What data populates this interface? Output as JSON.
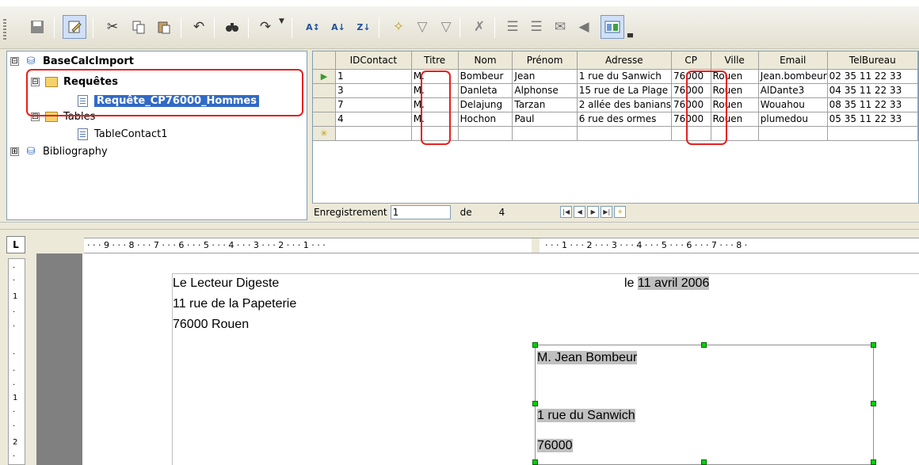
{
  "toolbar": {
    "icons": [
      "save-icon",
      "edit-icon",
      "cut-icon",
      "copy-icon",
      "paste-icon",
      "undo-icon",
      "find-icon",
      "redo-icon",
      "sort-icon",
      "sort-ascending-icon",
      "sort-descending-icon",
      "autofilter-icon",
      "filter-icon",
      "standard-filter-icon",
      "remove-filter-icon",
      "data-to-text-icon",
      "data-to-fields-icon",
      "mail-merge-icon",
      "data-source-icon",
      "explorer-icon"
    ],
    "grip": "partial"
  },
  "tree": {
    "database": "BaseCalcImport",
    "queries_folder": "Requêtes",
    "query_item": "Requête_CP76000_Hommes",
    "tables_folder": "Tables",
    "table_item": "TableContact1",
    "other_database": "Bibliography",
    "toggle_minus": "⊟",
    "toggle_plus": "⊞"
  },
  "grid": {
    "columns": [
      "IDContact",
      "Titre",
      "Nom",
      "Prénom",
      "Adresse",
      "CP",
      "Ville",
      "Email",
      "TelBureau"
    ],
    "rows": [
      [
        "1",
        "M.",
        "Bombeur",
        "Jean",
        "1 rue du Sanwich",
        "76000",
        "Rouen",
        "Jean.bombeur",
        "02 35 11 22 33"
      ],
      [
        "3",
        "M.",
        "Danleta",
        "Alphonse",
        "15 rue de La Plage",
        "76000",
        "Rouen",
        "AlDante3",
        "04 35 11 22 33"
      ],
      [
        "7",
        "M.",
        "Delajung",
        "Tarzan",
        "2 allée des banians",
        "76000",
        "Rouen",
        "Wouahou",
        "08 35 11 22 33"
      ],
      [
        "4",
        "M.",
        "Hochon",
        "Paul",
        "6 rue des ormes",
        "76000",
        "Rouen",
        "plumedou",
        "05 35 11 22 33"
      ]
    ],
    "current_row_marker": "▶",
    "new_row_marker": "✳"
  },
  "navigation": {
    "label": "Enregistrement",
    "current": "1",
    "of_label": "de",
    "total": "4",
    "buttons": [
      "|◀",
      "◀",
      "▶",
      "▶|",
      "✳"
    ]
  },
  "document": {
    "ruler_corner": "L",
    "sender_lines": [
      "Le Lecteur Digeste",
      "11 rue de la Papeterie",
      "76000 Rouen"
    ],
    "date_prefix": "le",
    "date_field": "11 avril 2006",
    "recipient_name": "M. Jean Bombeur",
    "recipient_street": "1 rue du Sanwich",
    "recipient_postcode": "76000",
    "ruler_left_marks": "· · · 9 · · · 8 · · · 7 · · · 6 · · · 5 · · · 4 · · · 3 · · · 2 · · · 1 · · ·",
    "ruler_right_marks": "· · · 1 · · · 2 · · · 3 · · · 4 · · · 5 · · · 6 · · · 7 · · · 8 ·",
    "vruler_marks": [
      "·",
      "·",
      "1",
      "·",
      "·",
      "·",
      "·",
      "·",
      "1",
      "·",
      "·",
      "2",
      "·"
    ]
  },
  "colors": {
    "highlight_red": "#e52020",
    "selection_blue": "#316ac5",
    "field_gray": "#c0c0c0",
    "handle_green": "#00d000"
  }
}
